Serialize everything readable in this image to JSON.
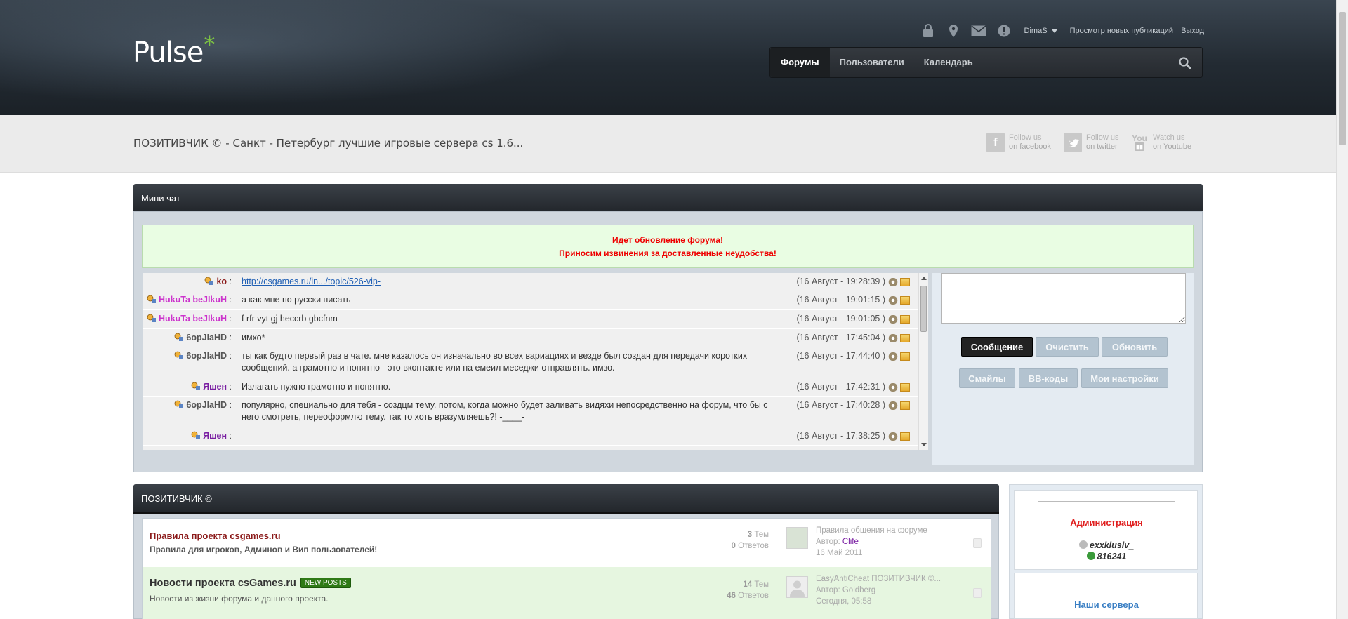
{
  "header": {
    "logo_text": "Pulse",
    "logo_star": "*",
    "user_links": {
      "username": "DimaS",
      "view_new": "Просмотр новых публикаций",
      "logout": "Выход"
    },
    "user_icons": [
      "lock-icon",
      "location-pin-icon",
      "mail-icon",
      "alert-icon"
    ],
    "nav": [
      {
        "label": "Форумы",
        "active": true
      },
      {
        "label": "Пользователи",
        "active": false
      },
      {
        "label": "Календарь",
        "active": false
      }
    ]
  },
  "subbar": {
    "board_title": "ПОЗИТИВЧИК © - Санкт - Петербург лучшие игровые сервера cs 1.6...",
    "social": [
      {
        "icon_text": "f",
        "line1": "Follow us",
        "line2": "on facebook"
      },
      {
        "icon_text": "t",
        "line1": "Follow us",
        "line2": "on twitter"
      },
      {
        "icon_text": "You",
        "line1": "Watch us",
        "line2": "on Youtube"
      }
    ]
  },
  "chat": {
    "title": "Мини чат",
    "notice_line1": "Идет обновление форума!",
    "notice_line2": "Приносим извинения за доставленные неудобства!",
    "messages": [
      {
        "author": "ko",
        "color": "#8b1a1a",
        "text": "http://csgames.ru/in.../topic/526-vip-",
        "is_link": true,
        "time": "(16 Август - 19:28:39 )"
      },
      {
        "author": "HukuTa beJIkuH",
        "color": "#cc33cc",
        "text": "а как мне по русски писать",
        "time": "(16 Август - 19:01:15 )"
      },
      {
        "author": "HukuTa beJIkuH",
        "color": "#cc33cc",
        "text": "f rfr vyt gj heccrb gbcfnm",
        "time": "(16 Август - 19:01:05 )"
      },
      {
        "author": "6opJIaHD",
        "color": "#555555",
        "text": "имхо*",
        "time": "(16 Август - 17:45:04 )"
      },
      {
        "author": "6opJIaHD",
        "color": "#555555",
        "text": "ты как будто первый раз в чате. мне казалось он изначально во всех вариациях и везде был создан для передачи коротких сообщений. а грамотно и понятно - это вконтакте или на емеил меседжи отправлять. имзо.",
        "time": "(16 Август - 17:44:40 )"
      },
      {
        "author": "Яшен",
        "color": "#7a1fa2",
        "text": "Излагать нужно грамотно и понятно.",
        "time": "(16 Август - 17:42:31 )"
      },
      {
        "author": "6opJIaHD",
        "color": "#555555",
        "text": "популярно, специально для тебя - создцм тему. потом, когда можно будет заливать видяхи непосредственно на форум, что бы с него смотреть, переоформлю тему. так то хоть вразумляешь?! -____-",
        "time": "(16 Август - 17:40:28 )"
      },
      {
        "author": "Яшен",
        "color": "#7a1fa2",
        "text": "",
        "time": "(16 Август - 17:38:25 )"
      }
    ],
    "buttons": {
      "send": "Сообщение",
      "clear": "Очистить",
      "refresh": "Обновить",
      "smiles": "Смайлы",
      "bbcodes": "BB-коды",
      "settings": "Мои настройки"
    }
  },
  "forum": {
    "title": "ПОЗИТИВЧИК ©",
    "rows": [
      {
        "name": "Правила проекта csgames.ru",
        "desc": "Правила для игроков, Админов и Вип пользователей!",
        "topics": "3",
        "topics_label": "Тем",
        "replies": "0",
        "replies_label": "Ответов",
        "last_title": "Правила общения на форуме",
        "last_author_label": "Автор:",
        "last_author": "Clife",
        "last_date": "16 Май 2011",
        "badge": ""
      },
      {
        "name": "Новости проекта csGames.ru",
        "desc": "Новости из жизни форума и данного проекта.",
        "topics": "14",
        "topics_label": "Тем",
        "replies": "46",
        "replies_label": "Ответов",
        "last_title": "EasyAntiCheat ПОЗИТИВЧИК ©...",
        "last_author_label": "Автор:",
        "last_author": "Goldberg",
        "last_date": "Сегодня, 05:58",
        "badge": "NEW POSTS"
      }
    ]
  },
  "sidebar": {
    "admin_title": "Администрация",
    "admin_users": [
      "exxklusiv_",
      "816241"
    ],
    "servers_title": "Наши сервера"
  },
  "colors": {
    "accent_green": "#7cc242",
    "admin_red": "#e02020",
    "servers_blue": "#3a7fc4"
  }
}
